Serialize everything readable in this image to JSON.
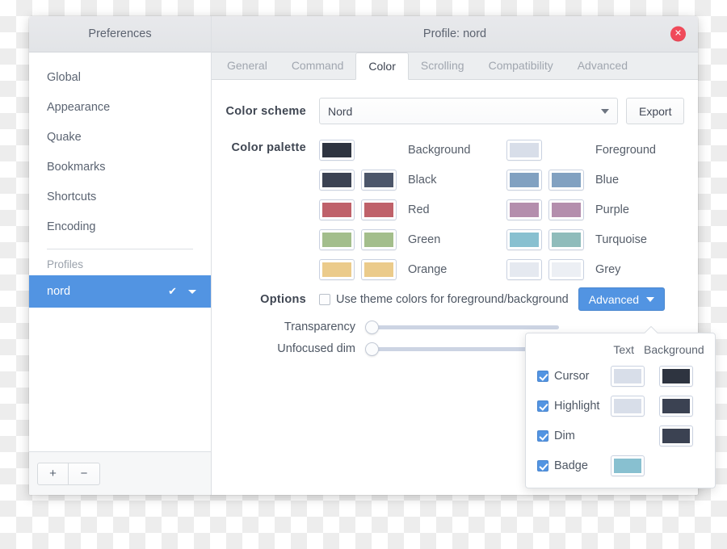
{
  "sidebar": {
    "header": "Preferences",
    "items": [
      {
        "label": "Global"
      },
      {
        "label": "Appearance"
      },
      {
        "label": "Quake"
      },
      {
        "label": "Bookmarks"
      },
      {
        "label": "Shortcuts"
      },
      {
        "label": "Encoding"
      }
    ],
    "section_title": "Profiles",
    "profile": {
      "name": "nord",
      "check_icon": "✔",
      "caret_icon": "caret-down-icon"
    },
    "footer": {
      "add_label": "+",
      "remove_label": "−"
    }
  },
  "titlebar": {
    "title": "Profile: nord",
    "close_label": "✕"
  },
  "tabs": [
    {
      "label": "General",
      "active": false
    },
    {
      "label": "Command",
      "active": false
    },
    {
      "label": "Color",
      "active": true
    },
    {
      "label": "Scrolling",
      "active": false
    },
    {
      "label": "Compatibility",
      "active": false
    },
    {
      "label": "Advanced",
      "active": false
    }
  ],
  "scheme": {
    "label": "Color scheme",
    "value": "Nord",
    "export_label": "Export"
  },
  "palette": {
    "label": "Color palette",
    "left": [
      {
        "name": "Background",
        "colors": [
          "#2e3440"
        ]
      },
      {
        "name": "Black",
        "colors": [
          "#3b4252",
          "#4c566a"
        ]
      },
      {
        "name": "Red",
        "colors": [
          "#bf616a",
          "#bf616a"
        ]
      },
      {
        "name": "Green",
        "colors": [
          "#a3be8c",
          "#a3be8c"
        ]
      },
      {
        "name": "Orange",
        "colors": [
          "#ebcb8b",
          "#ebcb8b"
        ]
      }
    ],
    "right": [
      {
        "name": "Foreground",
        "colors": [
          "#d8dee9"
        ]
      },
      {
        "name": "Blue",
        "colors": [
          "#81a1c1",
          "#81a1c1"
        ]
      },
      {
        "name": "Purple",
        "colors": [
          "#b48ead",
          "#b48ead"
        ]
      },
      {
        "name": "Turquoise",
        "colors": [
          "#88c0d0",
          "#8fbcbb"
        ]
      },
      {
        "name": "Grey",
        "colors": [
          "#e5e9f0",
          "#eceff4"
        ]
      }
    ]
  },
  "options": {
    "label": "Options",
    "theme_colors_label": "Use theme colors for foreground/background",
    "theme_colors_checked": false,
    "advanced_label": "Advanced",
    "advanced_caret_icon": "caret-down-icon"
  },
  "sliders": [
    {
      "label": "Transparency",
      "value": 0
    },
    {
      "label": "Unfocused dim",
      "value": 0
    }
  ],
  "popup": {
    "col_text": "Text",
    "col_background": "Background",
    "rows": [
      {
        "label": "Cursor",
        "checked": true,
        "text_color": "#d8dee9",
        "bg_color": "#2e3440"
      },
      {
        "label": "Highlight",
        "checked": true,
        "text_color": "#d8dee9",
        "bg_color": "#3b4252"
      },
      {
        "label": "Dim",
        "checked": true,
        "text_color": null,
        "bg_color": "#3b4252"
      },
      {
        "label": "Badge",
        "checked": true,
        "text_color": "#88c0d0",
        "bg_color": null
      }
    ]
  },
  "colors": {
    "accent": "#5294e2",
    "close": "#f04a5a"
  }
}
